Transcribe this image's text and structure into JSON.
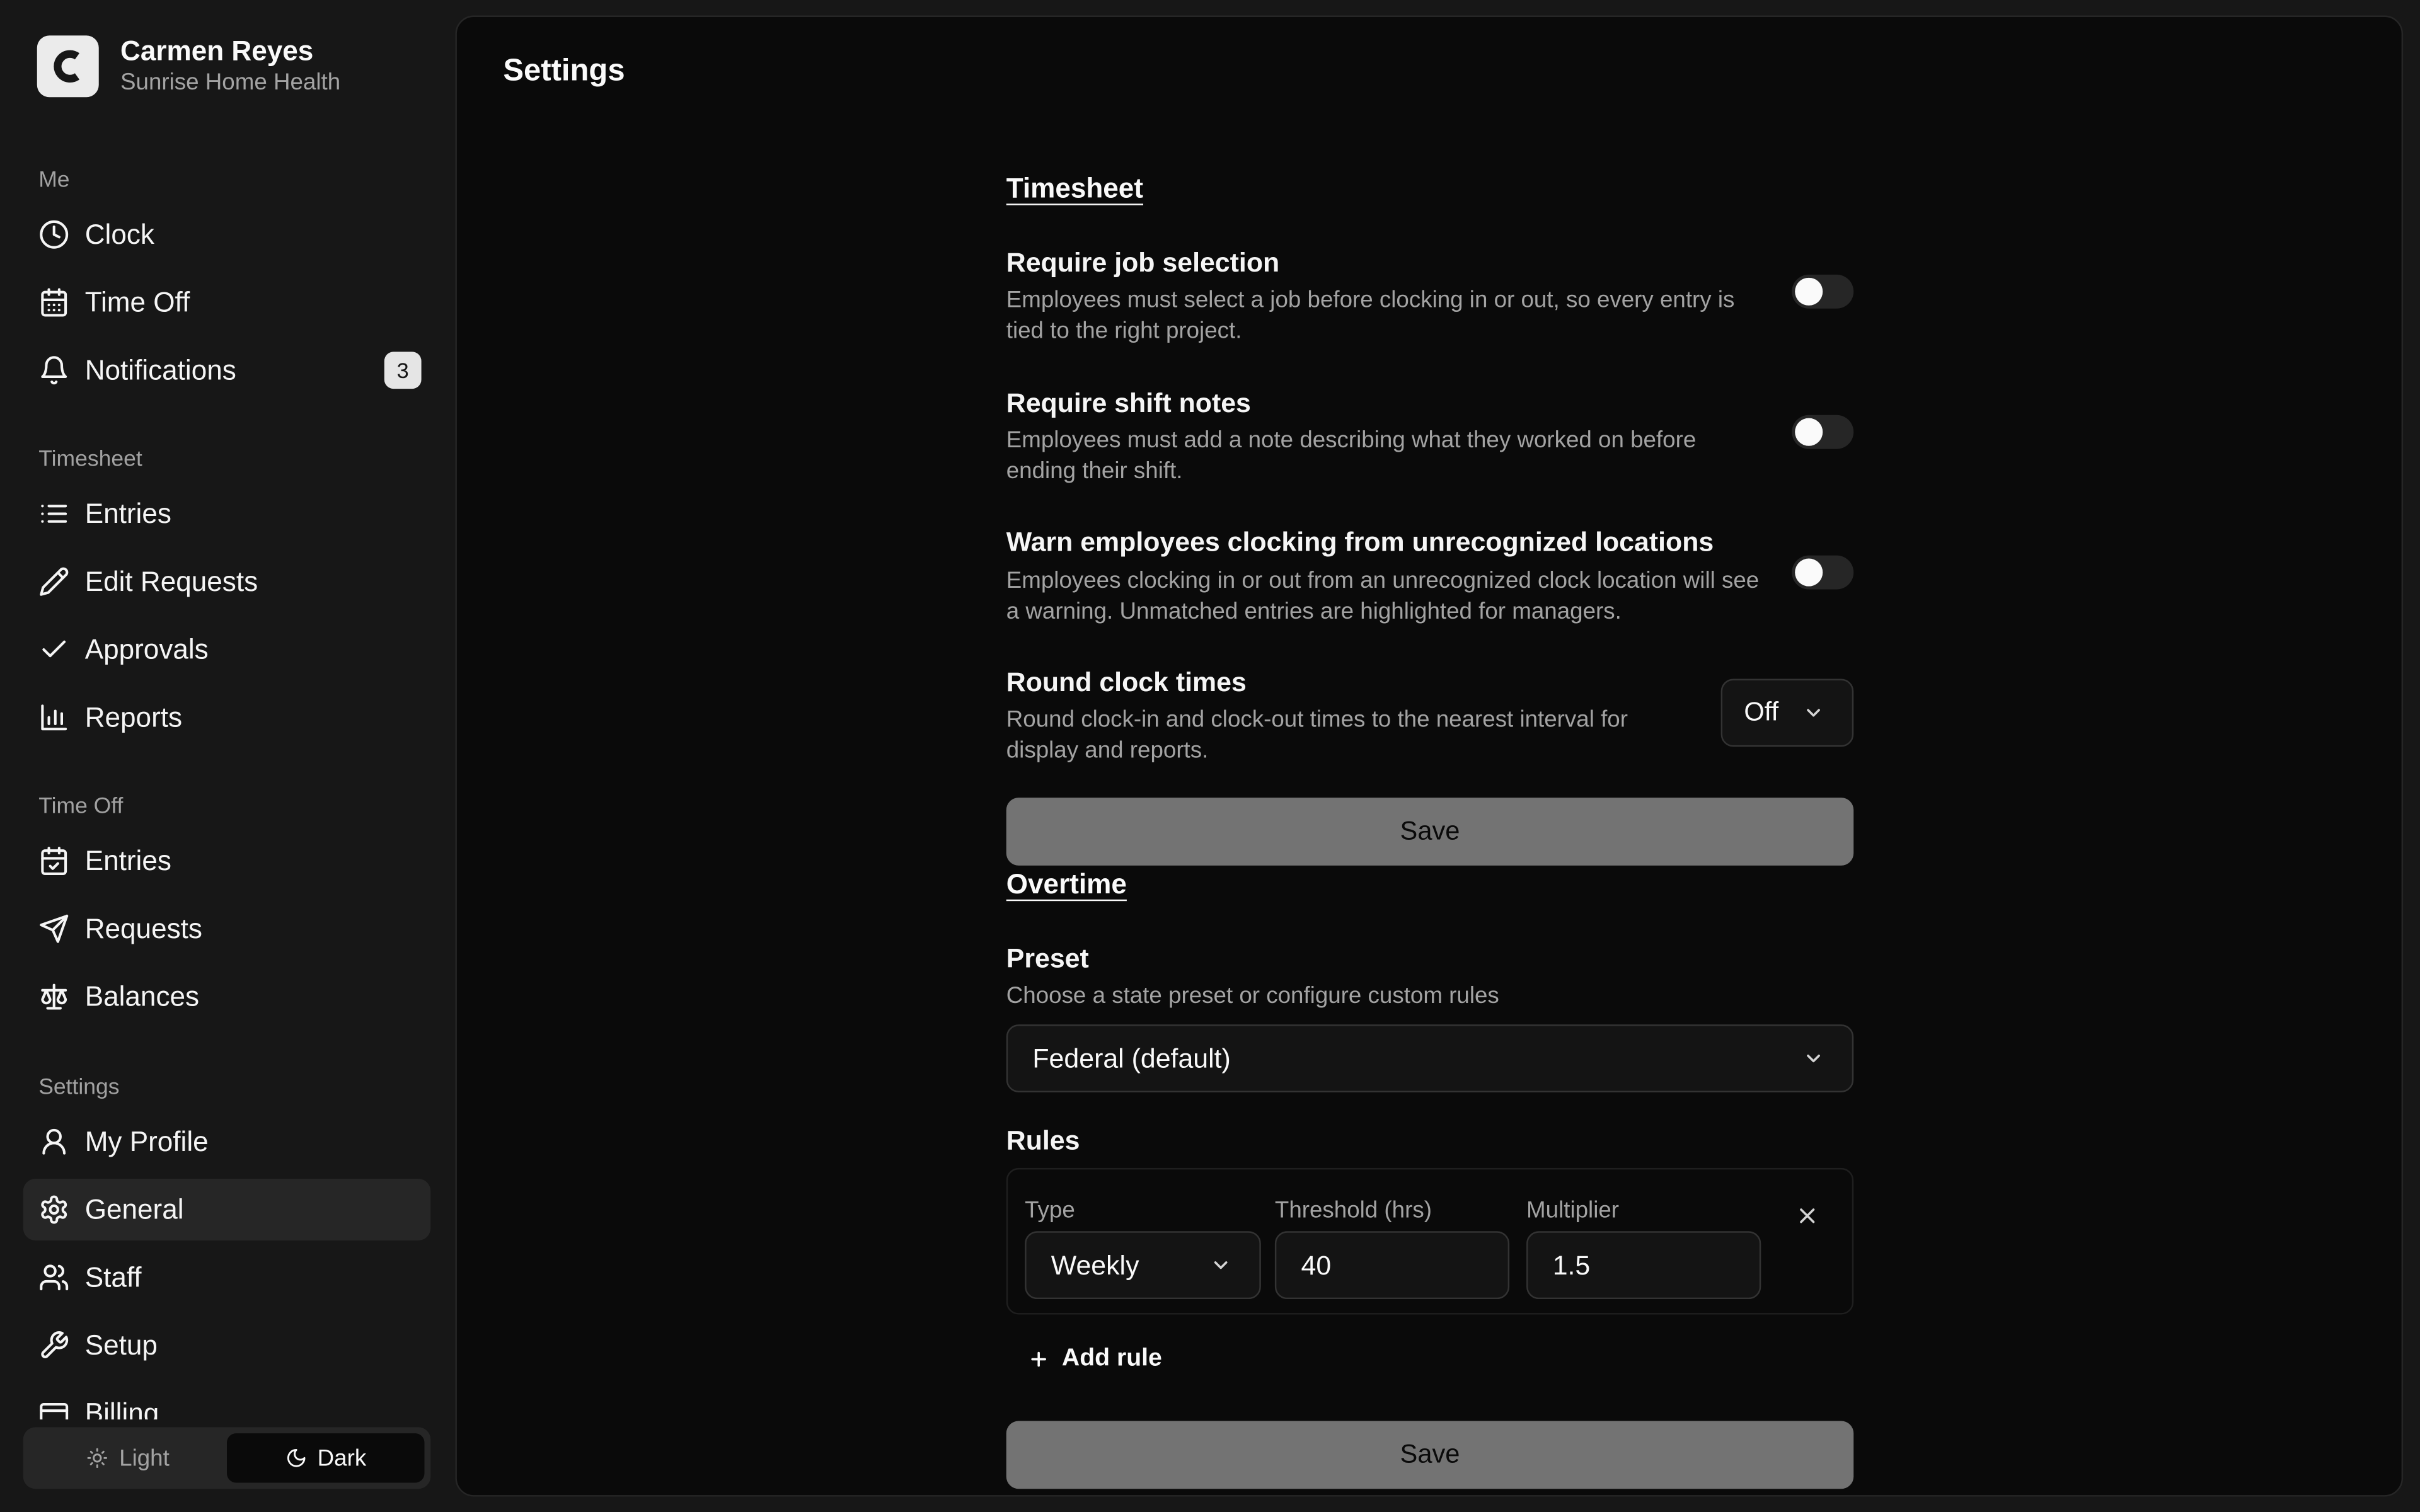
{
  "user": {
    "name": "Carmen Reyes",
    "org": "Sunrise Home Health",
    "logo_letter": "C"
  },
  "sidebar": {
    "groups": [
      {
        "label": "Me",
        "items": [
          {
            "label": "Clock",
            "icon": "clock-icon"
          },
          {
            "label": "Time Off",
            "icon": "calendar-icon"
          },
          {
            "label": "Notifications",
            "icon": "bell-icon",
            "badge": "3"
          }
        ]
      },
      {
        "label": "Timesheet",
        "items": [
          {
            "label": "Entries",
            "icon": "list-icon"
          },
          {
            "label": "Edit Requests",
            "icon": "pencil-icon"
          },
          {
            "label": "Approvals",
            "icon": "check-icon"
          },
          {
            "label": "Reports",
            "icon": "bar-chart-icon"
          }
        ]
      },
      {
        "label": "Time Off",
        "items": [
          {
            "label": "Entries",
            "icon": "calendar-check-icon"
          },
          {
            "label": "Requests",
            "icon": "send-icon"
          },
          {
            "label": "Balances",
            "icon": "scale-icon"
          }
        ]
      },
      {
        "label": "Settings",
        "items": [
          {
            "label": "My Profile",
            "icon": "user-icon"
          },
          {
            "label": "General",
            "icon": "gear-icon",
            "active": true
          },
          {
            "label": "Staff",
            "icon": "users-icon"
          },
          {
            "label": "Setup",
            "icon": "wrench-icon"
          },
          {
            "label": "Billing",
            "icon": "credit-card-icon"
          }
        ]
      }
    ],
    "theme": {
      "light": "Light",
      "dark": "Dark",
      "selected": "Dark"
    }
  },
  "main": {
    "title": "Settings",
    "timesheet": {
      "title": "Timesheet",
      "settings": [
        {
          "title": "Require job selection",
          "desc": "Employees must select a job before clocking in or out, so every entry is tied to the right project.",
          "enabled": false
        },
        {
          "title": "Require shift notes",
          "desc": "Employees must add a note describing what they worked on before ending their shift.",
          "enabled": false
        },
        {
          "title": "Warn employees clocking from unrecognized locations",
          "desc": "Employees clocking in or out from an unrecognized clock location will see a warning. Unmatched entries are highlighted for managers.",
          "enabled": false
        }
      ],
      "round": {
        "title": "Round clock times",
        "desc": "Round clock-in and clock-out times to the nearest interval for display and reports.",
        "value": "Off"
      },
      "save_label": "Save"
    },
    "overtime": {
      "title": "Overtime",
      "preset_title": "Preset",
      "preset_desc": "Choose a state preset or configure custom rules",
      "preset_value": "Federal (default)",
      "rules_title": "Rules",
      "rule_labels": {
        "type": "Type",
        "threshold": "Threshold (hrs)",
        "multiplier": "Multiplier"
      },
      "rules": [
        {
          "type": "Weekly",
          "threshold": "40",
          "multiplier": "1.5"
        }
      ],
      "add_rule_label": "Add rule",
      "save_label": "Save"
    }
  }
}
